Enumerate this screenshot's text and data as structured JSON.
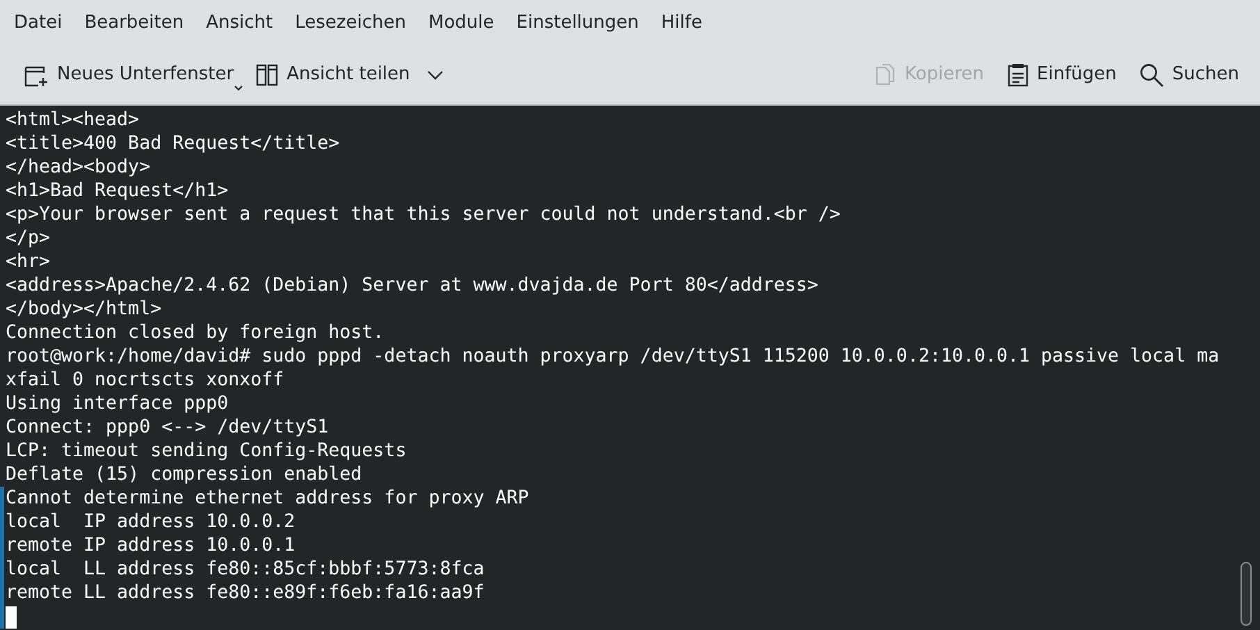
{
  "menu_bar": [
    {
      "label": "Datei"
    },
    {
      "label": "Bearbeiten"
    },
    {
      "label": "Ansicht"
    },
    {
      "label": "Lesezeichen"
    },
    {
      "label": "Module"
    },
    {
      "label": "Einstellungen"
    },
    {
      "label": "Hilfe"
    }
  ],
  "toolbar": {
    "left": [
      {
        "label": "Neues Unterfenster",
        "kind": "new-tab",
        "disabled": false
      },
      {
        "label": "Ansicht teilen",
        "kind": "split",
        "disabled": false
      }
    ],
    "right": [
      {
        "label": "Kopieren",
        "kind": "copy",
        "disabled": true
      },
      {
        "label": "Einfügen",
        "kind": "paste",
        "disabled": false
      },
      {
        "label": "Suchen",
        "kind": "search",
        "disabled": false
      }
    ]
  },
  "terminal": {
    "lines": [
      {
        "text": "<html><head>",
        "marked": false
      },
      {
        "text": "<title>400 Bad Request</title>",
        "marked": false
      },
      {
        "text": "</head><body>",
        "marked": false
      },
      {
        "text": "<h1>Bad Request</h1>",
        "marked": false
      },
      {
        "text": "<p>Your browser sent a request that this server could not understand.<br />",
        "marked": false
      },
      {
        "text": "</p>",
        "marked": false
      },
      {
        "text": "<hr>",
        "marked": false
      },
      {
        "text": "<address>Apache/2.4.62 (Debian) Server at www.dvajda.de Port 80</address>",
        "marked": false
      },
      {
        "text": "</body></html>",
        "marked": false
      },
      {
        "text": "Connection closed by foreign host.",
        "marked": false
      },
      {
        "text": "root@work:/home/david# sudo pppd -detach noauth proxyarp /dev/ttyS1 115200 10.0.0.2:10.0.0.1 passive local ma",
        "marked": false
      },
      {
        "text": "xfail 0 nocrtscts xonxoff",
        "marked": false
      },
      {
        "text": "Using interface ppp0",
        "marked": false
      },
      {
        "text": "Connect: ppp0 <--> /dev/ttyS1",
        "marked": false
      },
      {
        "text": "LCP: timeout sending Config-Requests",
        "marked": false
      },
      {
        "text": "Deflate (15) compression enabled",
        "marked": false
      },
      {
        "text": "Cannot determine ethernet address for proxy ARP",
        "marked": true
      },
      {
        "text": "local  IP address 10.0.0.2",
        "marked": true
      },
      {
        "text": "remote IP address 10.0.0.1",
        "marked": true
      },
      {
        "text": "local  LL address fe80::85cf:bbbf:5773:8fca",
        "marked": true
      },
      {
        "text": "remote LL address fe80::e89f:f6eb:fa16:aa9f",
        "marked": true
      }
    ],
    "cursor_marked": true
  }
}
